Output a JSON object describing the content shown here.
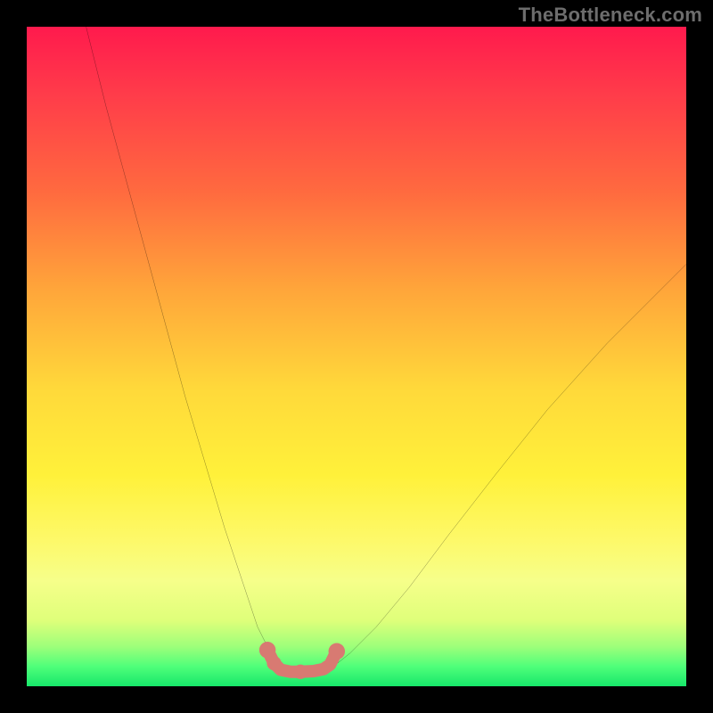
{
  "watermark": "TheBottleneck.com",
  "chart_data": {
    "type": "line",
    "title": "",
    "xlabel": "",
    "ylabel": "",
    "xlim": [
      0,
      100
    ],
    "ylim": [
      0,
      100
    ],
    "series": [
      {
        "name": "left-curve",
        "x": [
          9,
          12,
          15,
          18,
          21,
          24,
          27,
          30,
          33,
          35,
          37,
          38.5
        ],
        "y": [
          100,
          88,
          77,
          66,
          55,
          44,
          34,
          24,
          15,
          9,
          5,
          3
        ]
      },
      {
        "name": "right-curve",
        "x": [
          46.5,
          49,
          53,
          58,
          64,
          71,
          79,
          88,
          98,
          100
        ],
        "y": [
          3,
          5,
          9,
          15,
          23,
          32,
          42,
          52,
          62,
          64
        ]
      },
      {
        "name": "valley-dots",
        "x": [
          36.5,
          37.5,
          38.5,
          40,
          41.5,
          43.5,
          45,
          46,
          46.5,
          47
        ],
        "y": [
          5.5,
          3.5,
          2.5,
          2.2,
          2.2,
          2.3,
          2.6,
          3.3,
          4.3,
          5.3
        ]
      }
    ],
    "colors": {
      "curve": "#000000",
      "dots": "#d87a72"
    }
  }
}
